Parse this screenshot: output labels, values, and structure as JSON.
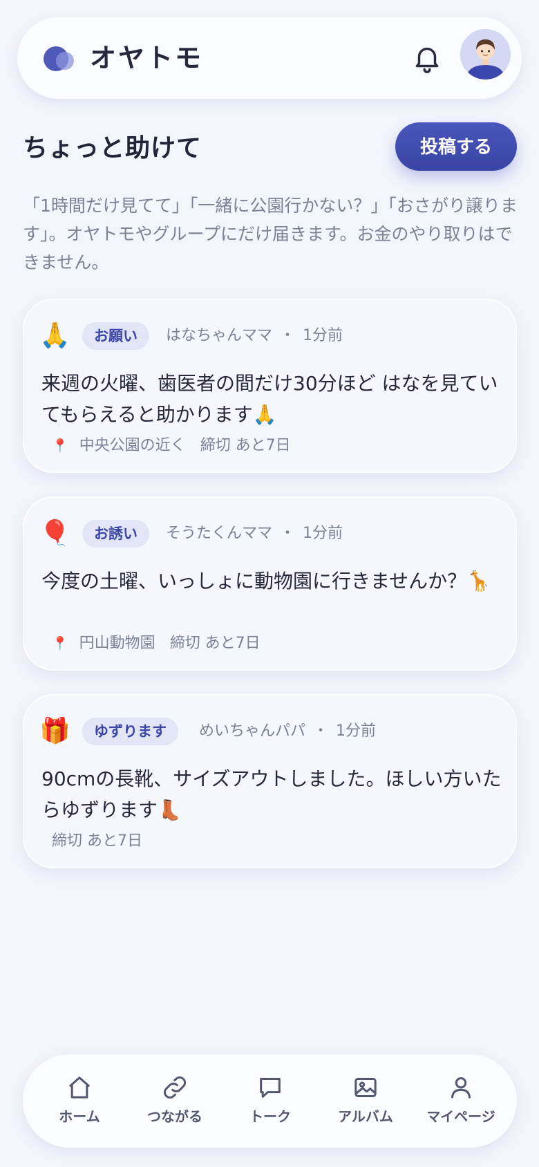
{
  "app": {
    "title": "オヤトモ"
  },
  "section": {
    "title": "ちょっと助けて",
    "post_button": "投稿する",
    "description": "「1時間だけ見てて」「一緒に公園行かない？」「おさがり譲ります」。オヤトモやグループにだけ届きます。お金のやり取りはできません。"
  },
  "posts": [
    {
      "emoji": "🙏",
      "tag": "お願い",
      "author": "はなちゃんママ",
      "time": "1分前",
      "body": "来週の火曜、歯医者の間だけ30分ほど はなを見ていてもらえると助かります🙏",
      "location": "中央公園の近く",
      "deadline": "締切 あと7日"
    },
    {
      "emoji": "🎈",
      "tag": "お誘い",
      "author": "そうたくんママ",
      "time": "1分前",
      "body": "今度の土曜、いっしょに動物園に行きませんか？🦒",
      "location": "円山動物園",
      "deadline": "締切 あと7日"
    },
    {
      "emoji": "🎁",
      "tag": "ゆずります",
      "author": "めいちゃんパパ",
      "time": "1分前",
      "body": "90cmの長靴、サイズアウトしました。ほしい方いたらゆずります👢",
      "deadline": "締切 あと7日"
    }
  ],
  "nav": {
    "home": "ホーム",
    "connect": "つながる",
    "talk": "トーク",
    "album": "アルバム",
    "mypage": "マイページ"
  },
  "icons": {
    "pin": "📍",
    "separator": "・"
  },
  "colors": {
    "accent": "#3f49ad",
    "background": "#f3f5fc",
    "tag_bg": "#e1e5f6",
    "pin": "#e24848"
  }
}
